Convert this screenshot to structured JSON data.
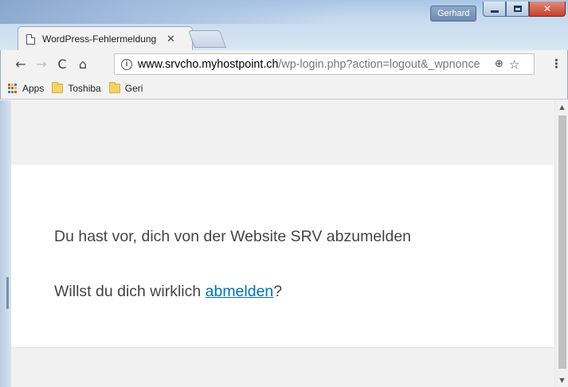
{
  "window": {
    "user_badge": "Gerhard",
    "controls": {
      "minimize": "–",
      "maximize": "□",
      "close": "✕"
    }
  },
  "tab": {
    "title": "WordPress-Fehlermeldung",
    "close_glyph": "✕",
    "icon": "page-icon"
  },
  "toolbar": {
    "back_glyph": "←",
    "forward_glyph": "→",
    "reload_glyph": "C",
    "home_glyph": "⌂",
    "info_glyph": "i",
    "url_host": "www.srvcho.myhostpoint.ch",
    "url_path": "/wp-login.php?action=logout&_wpnonce",
    "zoom_glyph": "⊕",
    "star_glyph": "☆",
    "menu_glyph": "⋮"
  },
  "bookmarks": {
    "items": [
      {
        "label": "Apps",
        "icon": "apps-grid-icon"
      },
      {
        "label": "Toshiba",
        "icon": "folder-icon"
      },
      {
        "label": "Geri",
        "icon": "folder-icon"
      }
    ]
  },
  "page": {
    "line1": "Du hast vor, dich von der Website SRV abzumelden",
    "line2_prefix": "Willst du dich wirklich ",
    "line2_link": "abmelden",
    "line2_suffix": "?"
  },
  "colors": {
    "link": "#0073aa",
    "text": "#444444",
    "page_bg": "#f1f1f1",
    "apps_grid": [
      "#e2463b",
      "#f6b928",
      "#3c7ae4",
      "#2fa55a",
      "#e2463b",
      "#f6b928",
      "#3c7ae4",
      "#2fa55a",
      "#e2463b"
    ]
  },
  "scrollbar": {
    "up_glyph": "▲",
    "down_glyph": "▼",
    "position": 0
  }
}
